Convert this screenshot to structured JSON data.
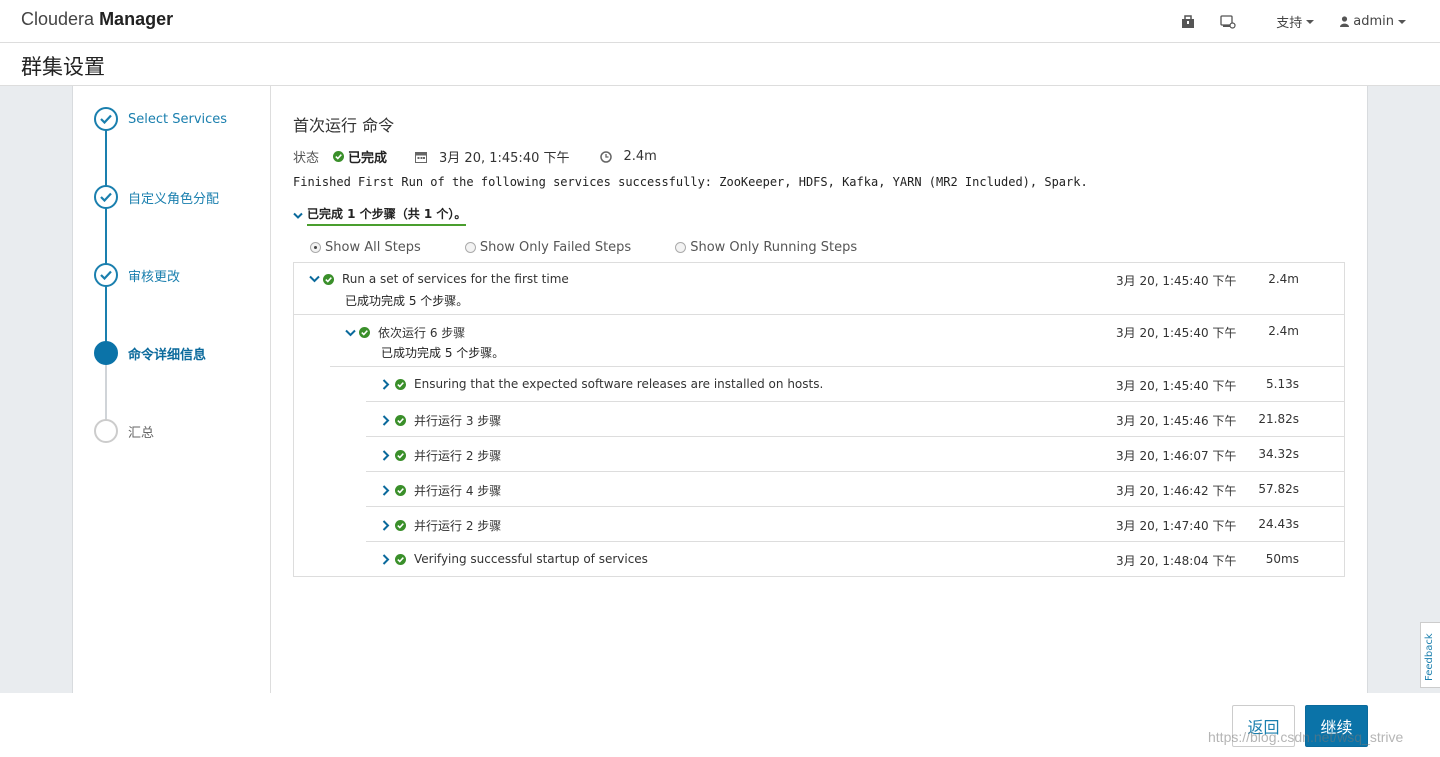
{
  "header": {
    "brand_light": "Cloudera",
    "brand_bold": "Manager",
    "support_label": "支持",
    "user_label": "admin"
  },
  "page": {
    "title": "群集设置"
  },
  "wizard": {
    "steps": [
      {
        "label": "Select Services",
        "state": "done"
      },
      {
        "label": "自定义角色分配",
        "state": "done"
      },
      {
        "label": "审核更改",
        "state": "done"
      },
      {
        "label": "命令详细信息",
        "state": "active"
      },
      {
        "label": "汇总",
        "state": "pending"
      }
    ]
  },
  "command": {
    "title": "首次运行 命令",
    "status_key": "状态",
    "status_value": "已完成",
    "start_time": "3月 20, 1:45:40 下午",
    "duration": "2.4m",
    "message": "Finished First Run of the following services successfully: ZooKeeper, HDFS, Kafka, YARN (MR2 Included), Spark.",
    "summary_link": "已完成 1 个步骤（共 1 个）。"
  },
  "filters": {
    "all": "Show All Steps",
    "failed": "Show Only Failed Steps",
    "running": "Show Only Running Steps"
  },
  "rows": [
    {
      "name": "Run a set of services for the first time",
      "sub": "已成功完成  5  个步骤。",
      "ts": "3月 20, 1:45:40 下午",
      "dur": "2.4m"
    },
    {
      "name": "依次运行 6 步骤",
      "sub": "已成功完成  5  个步骤。",
      "ts": "3月 20, 1:45:40 下午",
      "dur": "2.4m"
    },
    {
      "name": "Ensuring that the expected software releases are installed on hosts.",
      "ts": "3月 20, 1:45:40 下午",
      "dur": "5.13s"
    },
    {
      "name": "并行运行 3 步骤",
      "ts": "3月 20, 1:45:46 下午",
      "dur": "21.82s"
    },
    {
      "name": "并行运行 2 步骤",
      "ts": "3月 20, 1:46:07 下午",
      "dur": "34.32s"
    },
    {
      "name": "并行运行 4 步骤",
      "ts": "3月 20, 1:46:42 下午",
      "dur": "57.82s"
    },
    {
      "name": "并行运行 2 步骤",
      "ts": "3月 20, 1:47:40 下午",
      "dur": "24.43s"
    },
    {
      "name": "Verifying successful startup of services",
      "ts": "3月 20, 1:48:04 下午",
      "dur": "50ms"
    }
  ],
  "footer": {
    "back_label": "返回",
    "next_label": "继续",
    "watermark": "https://blog.csdn.net/wsq_strive",
    "feedback": "Feedback"
  },
  "colors": {
    "accent": "#0b73a8",
    "success": "#3a8f2a"
  }
}
